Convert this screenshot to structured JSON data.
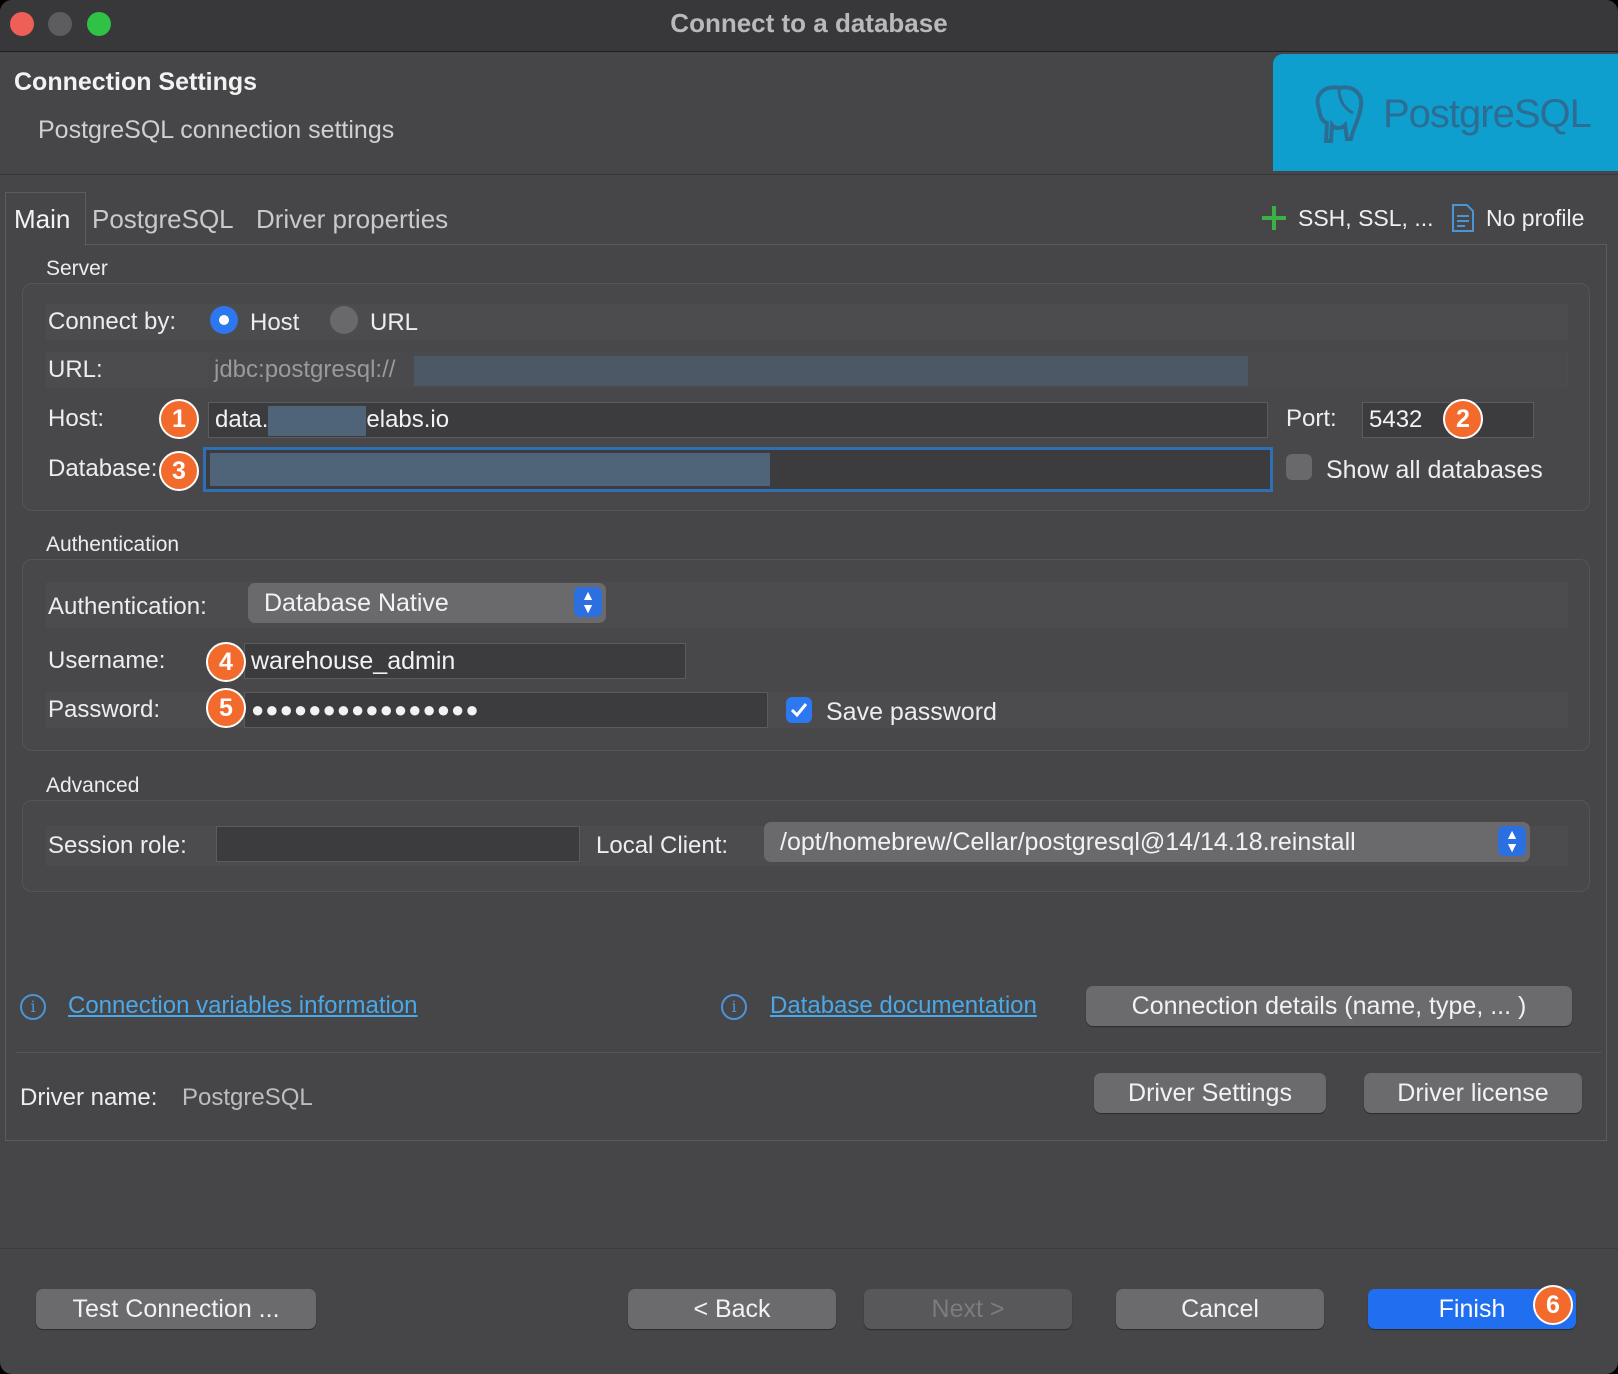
{
  "window": {
    "title": "Connect to a database"
  },
  "header": {
    "title": "Connection Settings",
    "subtitle": "PostgreSQL connection settings",
    "logo_text": "PostgreSQL"
  },
  "tabs": [
    {
      "label": "Main"
    },
    {
      "label": "PostgreSQL"
    },
    {
      "label": "Driver properties"
    }
  ],
  "toolbar": {
    "ssh_label": "SSH, SSL, ...",
    "profile_label": "No profile"
  },
  "server": {
    "group_title": "Server",
    "connect_by_label": "Connect by:",
    "host_option": "Host",
    "url_option": "URL",
    "url_label": "URL:",
    "url_value": "jdbc:postgresql://",
    "host_label": "Host:",
    "host_value_prefix": "data.",
    "host_value_suffix": "elabs.io",
    "port_label": "Port:",
    "port_value": "5432",
    "database_label": "Database:",
    "database_value": "",
    "show_all_label": "Show all databases"
  },
  "auth": {
    "group_title": "Authentication",
    "auth_label": "Authentication:",
    "auth_value": "Database Native",
    "username_label": "Username:",
    "username_value": "warehouse_admin",
    "password_label": "Password:",
    "password_value": "●●●●●●●●●●●●●●●●",
    "save_password_label": "Save password"
  },
  "advanced": {
    "group_title": "Advanced",
    "session_role_label": "Session role:",
    "session_role_value": "",
    "local_client_label": "Local Client:",
    "local_client_value": "/opt/homebrew/Cellar/postgresql@14/14.18.reinstall"
  },
  "links": {
    "conn_vars": "Connection variables information",
    "db_docs": "Database documentation"
  },
  "buttons": {
    "conn_details": "Connection details (name, type, ... )",
    "driver_settings": "Driver Settings",
    "driver_license": "Driver license",
    "test": "Test Connection ...",
    "back": "< Back",
    "next": "Next >",
    "cancel": "Cancel",
    "finish": "Finish"
  },
  "driver": {
    "label": "Driver name:",
    "value": "PostgreSQL"
  },
  "badges": [
    "1",
    "2",
    "3",
    "4",
    "5",
    "6"
  ],
  "colors": {
    "accent": "#1f6ff0",
    "badge": "#f26b2c",
    "link": "#4aa8e8",
    "logo_bg": "#0f9fcf"
  }
}
